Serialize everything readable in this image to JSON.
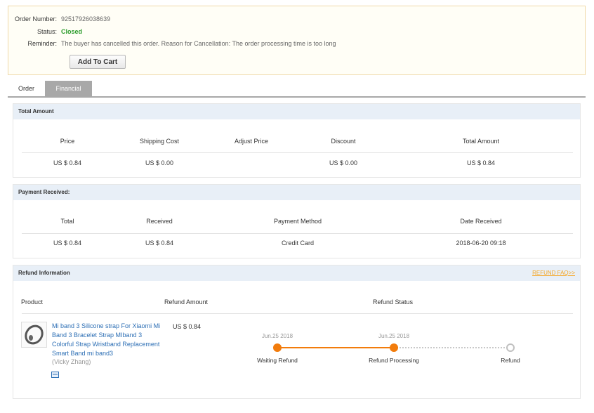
{
  "order": {
    "number_label": "Order Number:",
    "number": "92517926038639",
    "status_label": "Status:",
    "status": "Closed",
    "reminder_label": "Reminder:",
    "reminder": "The buyer has cancelled this order. Reason for Cancellation: The order processing time is too long",
    "add_to_cart": "Add To Cart"
  },
  "tabs": {
    "order": "Order",
    "financial": "Financial",
    "active": "Financial"
  },
  "total_amount": {
    "title": "Total Amount",
    "headers": [
      "Price",
      "Shipping Cost",
      "Adjust Price",
      "Discount",
      "Total Amount"
    ],
    "values": [
      "US $ 0.84",
      "US $ 0.00",
      "",
      "US $ 0.00",
      "US $ 0.84"
    ]
  },
  "payment": {
    "title": "Payment Received:",
    "headers": [
      "Total",
      "Received",
      "Payment Method",
      "Date Received"
    ],
    "values": [
      "US $ 0.84",
      "US $ 0.84",
      "Credit Card",
      "2018-06-20 09:18"
    ]
  },
  "refund": {
    "title": "Refund Information",
    "faq": "REFUND FAQ>>",
    "headers": {
      "product": "Product",
      "amount": "Refund Amount",
      "status": "Refund Status"
    },
    "product_title": "Mi band 3 Silicone strap For Xiaomi Mi Band 3 Bracelet Strap MIband 3 Colorful Strap Wristband Replacement Smart Band mi band3",
    "seller": "(Vicky Zhang)",
    "amount": "US $ 0.84",
    "steps": [
      {
        "date": "Jun.25 2018",
        "label": "Waiting Refund",
        "done": true
      },
      {
        "date": "Jun.25 2018",
        "label": "Refund Processing",
        "done": true
      },
      {
        "date": "",
        "label": "Refund",
        "done": false
      }
    ]
  },
  "colors": {
    "accent": "#f27c0c",
    "link": "#2d6fb5",
    "status_closed": "#2a9b2a",
    "panel_header": "#e8eff7",
    "faq": "#f5a623"
  }
}
